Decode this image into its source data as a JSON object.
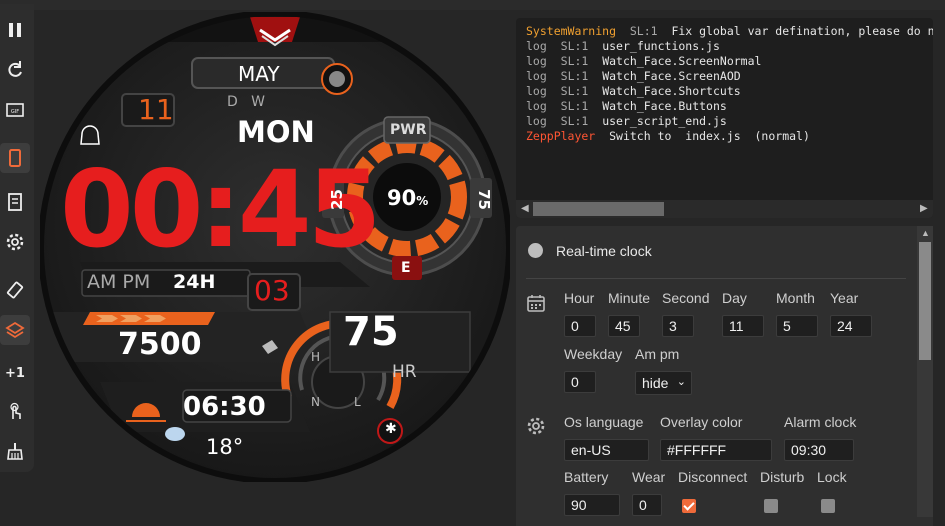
{
  "toolbar": {
    "items": [
      {
        "name": "pause-icon"
      },
      {
        "name": "reload-icon"
      },
      {
        "name": "gif-icon"
      },
      {
        "name": "device-icon",
        "active": true
      },
      {
        "name": "document-icon"
      },
      {
        "name": "gear-icon"
      },
      {
        "name": "rotate-icon"
      },
      {
        "name": "layers-icon",
        "active": true
      },
      {
        "name": "plus-one-icon"
      },
      {
        "name": "touch-icon"
      },
      {
        "name": "broom-icon"
      }
    ]
  },
  "watch": {
    "month": "MAY",
    "day_num": "11",
    "dow_letters": "D   W",
    "weekday": "MON",
    "time": "00:45",
    "ampm": "AM PM",
    "h24": "24H",
    "week_num": "03",
    "pwr_label": "PWR",
    "battery": "90",
    "battery_unit": "%",
    "gauge_left": "25",
    "gauge_right": "75",
    "gauge_bottom": "E",
    "steps": "7500",
    "hr": "75",
    "hr_unit": "HR",
    "compass": [
      "H",
      "N",
      "L"
    ],
    "sunset": "06:30",
    "temp": "18°",
    "colors": {
      "accent": "#e61e1e",
      "orange": "#e9621d"
    }
  },
  "console": {
    "lines": [
      {
        "level": "SystemWarning",
        "sl": "SL:1",
        "msg": "Fix global var defination, please do n"
      },
      {
        "level": "log",
        "sl": "SL:1",
        "msg": "user_functions.js"
      },
      {
        "level": "log",
        "sl": "SL:1",
        "msg": "Watch_Face.ScreenNormal"
      },
      {
        "level": "log",
        "sl": "SL:1",
        "msg": "Watch_Face.ScreenAOD"
      },
      {
        "level": "log",
        "sl": "SL:1",
        "msg": "Watch_Face.Shortcuts"
      },
      {
        "level": "log",
        "sl": "SL:1",
        "msg": "Watch_Face.Buttons"
      },
      {
        "level": "log",
        "sl": "SL:1",
        "msg": "user_script_end.js"
      },
      {
        "level": "ZeppPlayer",
        "sl": "",
        "msg": "Switch to  index.js  (normal)"
      }
    ]
  },
  "panel": {
    "realtime_label": "Real-time clock",
    "labels": {
      "hour": "Hour",
      "minute": "Minute",
      "second": "Second",
      "day": "Day",
      "month": "Month",
      "year": "Year",
      "weekday": "Weekday",
      "ampm": "Am pm",
      "os_language": "Os language",
      "overlay_color": "Overlay color",
      "alarm_clock": "Alarm clock",
      "battery": "Battery",
      "wear": "Wear",
      "disconnect": "Disconnect",
      "disturb": "Disturb",
      "lock": "Lock"
    },
    "values": {
      "hour": "0",
      "minute": "45",
      "second": "3",
      "day": "11",
      "month": "5",
      "year": "24",
      "weekday": "0",
      "ampm": "hide",
      "os_language": "en-US",
      "overlay_color": "#FFFFFF",
      "alarm_clock": "09:30",
      "battery": "90",
      "wear": "0"
    },
    "checks": {
      "disconnect": true,
      "disturb": false,
      "lock": false
    }
  }
}
